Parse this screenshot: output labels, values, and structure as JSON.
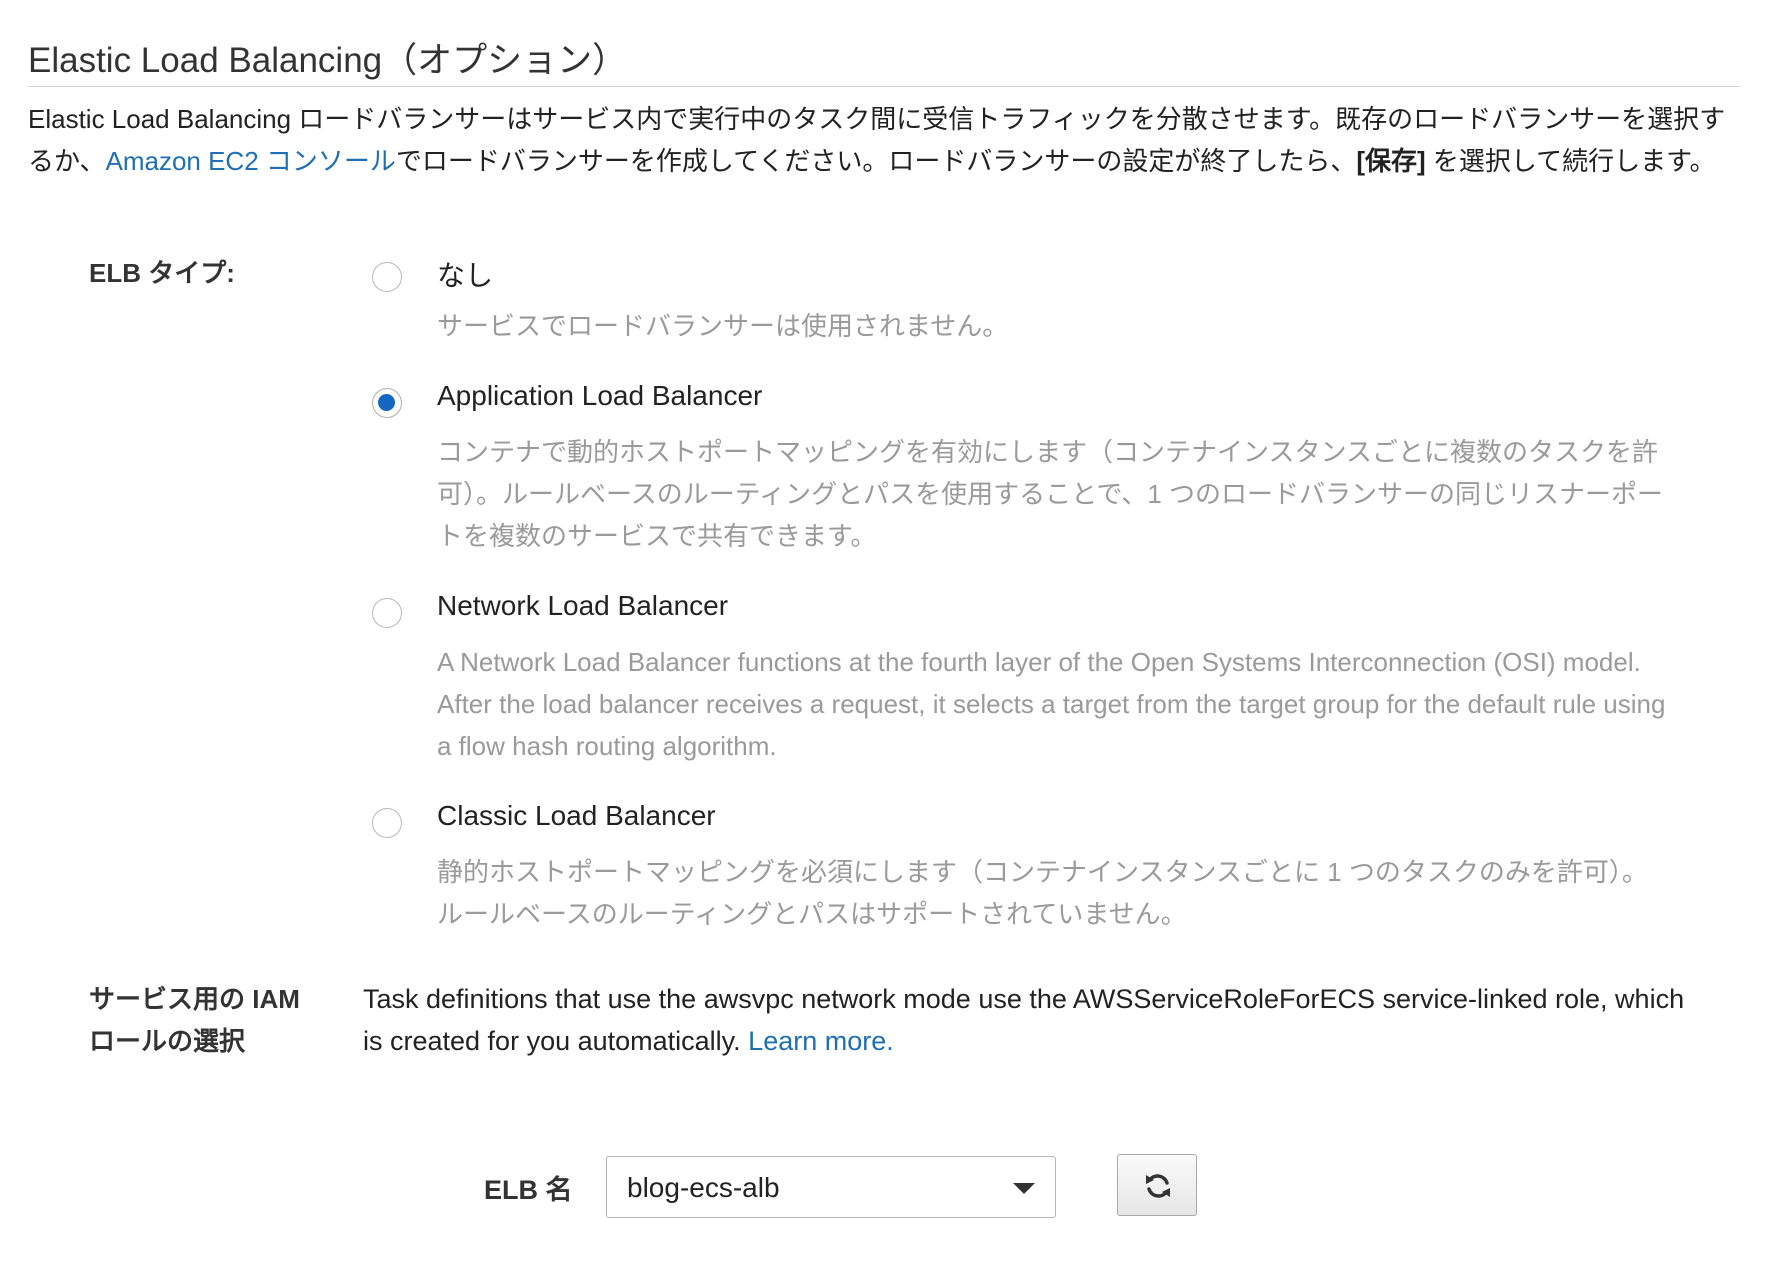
{
  "section": {
    "title": "Elastic Load Balancing（オプション）",
    "description_before_link": "Elastic Load Balancing ロードバランサーはサービス内で実行中のタスク間に受信トラフィックを分散させます。既存のロードバランサーを選択するか、",
    "description_link": "Amazon EC2 コンソール",
    "description_after_link": "でロードバランサーを作成してください。ロードバランサーの設定が終了したら、",
    "description_bold": "[保存]",
    "description_end": " を選択して続行します。"
  },
  "elb_type": {
    "label": "ELB タイプ:",
    "options": [
      {
        "label": "なし",
        "description": "サービスでロードバランサーは使用されません。",
        "selected": false
      },
      {
        "label": "Application Load Balancer",
        "description": "コンテナで動的ホストポートマッピングを有効にします（コンテナインスタンスごとに複数のタスクを許可）。ルールベースのルーティングとパスを使用することで、1 つのロードバランサーの同じリスナーポートを複数のサービスで共有できます。",
        "selected": true
      },
      {
        "label": "Network Load Balancer",
        "description": "A Network Load Balancer functions at the fourth layer of the Open Systems Interconnection (OSI) model. After the load balancer receives a request, it selects a target from the target group for the default rule using a flow hash routing algorithm.",
        "selected": false
      },
      {
        "label": "Classic Load Balancer",
        "description": "静的ホストポートマッピングを必須にします（コンテナインスタンスごとに 1 つのタスクのみを許可）。ルールベースのルーティングとパスはサポートされていません。",
        "selected": false
      }
    ]
  },
  "iam_role": {
    "label": "サービス用の IAM ロールの選択",
    "text": "Task definitions that use the awsvpc network mode use the AWSServiceRoleForECS service-linked role, which is created for you automatically. ",
    "link": "Learn more."
  },
  "elb_name": {
    "label": "ELB 名",
    "selected_value": "blog-ecs-alb",
    "refresh_icon": "refresh-icon"
  },
  "colors": {
    "link": "#1f6fb5",
    "radio_selected": "#1566c0",
    "muted_text": "#9a9a9a"
  }
}
